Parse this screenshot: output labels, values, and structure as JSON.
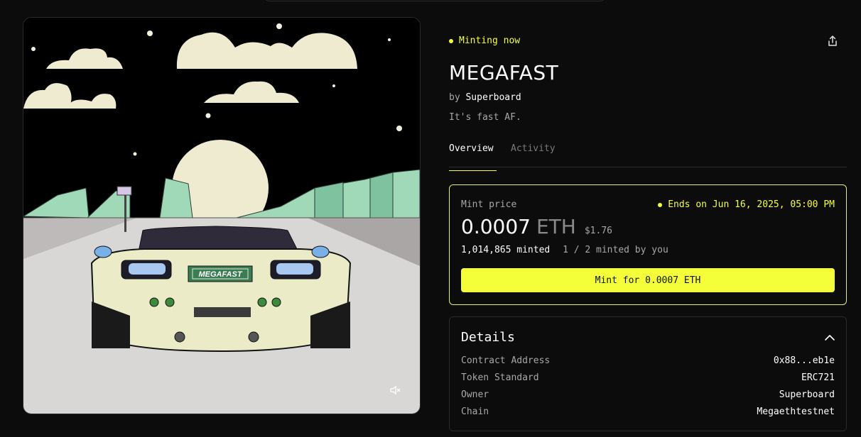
{
  "status": {
    "label": "Minting now"
  },
  "collection": {
    "title": "MEGAFAST",
    "by_prefix": "by",
    "creator": "Superboard",
    "description": "It's fast AF."
  },
  "tabs": [
    {
      "label": "Overview",
      "active": true
    },
    {
      "label": "Activity",
      "active": false
    }
  ],
  "mint": {
    "price_label": "Mint price",
    "ends_text": "Ends on Jun 16, 2025, 05:00 PM",
    "price_value": "0.0007",
    "price_currency": "ETH",
    "price_usd": "$1.76",
    "minted_total": "1,014,865 minted",
    "minted_by_you": "1 / 2 minted by you",
    "button_label": "Mint for 0.0007 ETH"
  },
  "details": {
    "title": "Details",
    "rows": [
      {
        "key": "Contract Address",
        "value": "0x88...eb1e"
      },
      {
        "key": "Token Standard",
        "value": "ERC721"
      },
      {
        "key": "Owner",
        "value": "Superboard"
      },
      {
        "key": "Chain",
        "value": "Megaethtestnet"
      }
    ]
  },
  "artwork": {
    "plate_text": "MEGAFAST"
  },
  "icons": {
    "share": "share-icon",
    "chevron": "chevron-up-icon",
    "mute": "mute-icon"
  },
  "colors": {
    "accent": "#f4ff3a",
    "background": "#0c0c0d"
  }
}
